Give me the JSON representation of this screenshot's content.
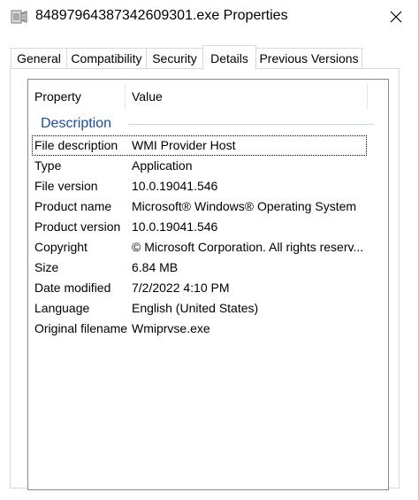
{
  "window": {
    "title": "84897964387342609301.exe Properties",
    "icon": "exe-file-icon",
    "close_glyph": "✕"
  },
  "tabs": [
    {
      "label": "General",
      "active": false
    },
    {
      "label": "Compatibility",
      "active": false
    },
    {
      "label": "Security",
      "active": false
    },
    {
      "label": "Details",
      "active": true
    },
    {
      "label": "Previous Versions",
      "active": false
    }
  ],
  "details": {
    "columns": {
      "property": "Property",
      "value": "Value"
    },
    "group": "Description",
    "rows": [
      {
        "property": "File description",
        "value": "WMI Provider Host"
      },
      {
        "property": "Type",
        "value": "Application"
      },
      {
        "property": "File version",
        "value": "10.0.19041.546"
      },
      {
        "property": "Product name",
        "value": "Microsoft® Windows® Operating System"
      },
      {
        "property": "Product version",
        "value": "10.0.19041.546"
      },
      {
        "property": "Copyright",
        "value": "© Microsoft Corporation. All rights reserv..."
      },
      {
        "property": "Size",
        "value": "6.84 MB"
      },
      {
        "property": "Date modified",
        "value": "7/2/2022 4:10 PM"
      },
      {
        "property": "Language",
        "value": "English (United States)"
      },
      {
        "property": "Original filename",
        "value": "Wmiprvse.exe"
      }
    ]
  },
  "colors": {
    "group_header": "#1e4e9f",
    "list_border": "#828790"
  }
}
